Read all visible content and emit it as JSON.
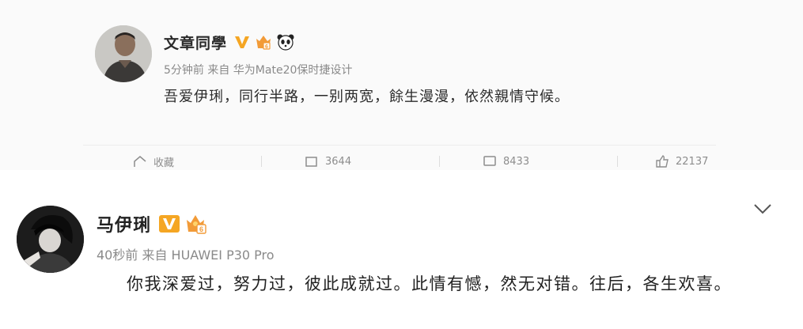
{
  "top_post": {
    "username": "文章同學",
    "meta": "5分钟前 来自 华为Mate20保时捷设计",
    "text": "吾爱伊琍，同行半路，一别两宽，餘生漫漫，依然親情守候。",
    "actions": [
      {
        "icon": "share-icon",
        "label": "收藏"
      },
      {
        "icon": "repost-icon",
        "label": "3644"
      },
      {
        "icon": "comment-icon",
        "label": "8433"
      },
      {
        "icon": "like-icon",
        "label": "22137"
      }
    ]
  },
  "bottom_post": {
    "username": "马伊琍",
    "meta": "40秒前 来自 HUAWEI P30 Pro",
    "text": "你我深爱过，努力过，彼此成就过。此情有憾，然无对错。往后，各生欢喜。"
  },
  "badges": {
    "verified_color": "#f5a623",
    "verified_text": "V",
    "level_text": "6"
  },
  "icons": [
    "verified-v-icon",
    "crown-level-icon",
    "panda-icon",
    "chevron-down-icon"
  ]
}
